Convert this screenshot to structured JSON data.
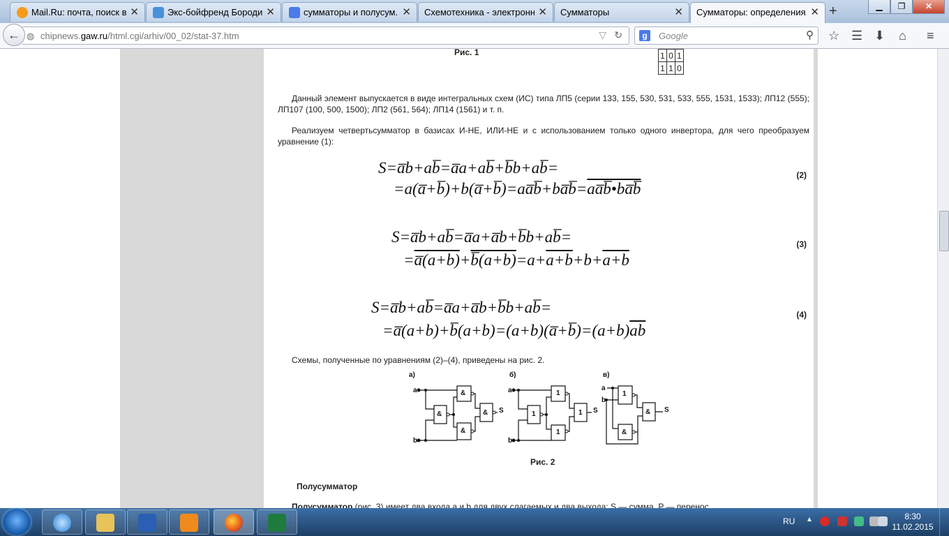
{
  "browser": {
    "tabs": [
      {
        "label": "Mail.Ru: почта, поиск в...",
        "icon": "mailru-icon",
        "color": "#f59b1a"
      },
      {
        "label": "Экс-бойфренд Бороди...",
        "icon": "person-icon",
        "color": "#4a90d9"
      },
      {
        "label": "сумматоры и полусум...",
        "icon": "google-icon",
        "color": "#4a7be8"
      },
      {
        "label": "Схемотехника - электронн...",
        "icon": "page-icon",
        "color": "#dddddd"
      },
      {
        "label": "Сумматоры",
        "icon": "page-icon",
        "color": "#dddddd"
      },
      {
        "label": "Сумматоры: определения,...",
        "icon": "page-icon",
        "color": "#dddddd"
      }
    ],
    "new_tab": "+",
    "url_prefix": "chipnews.",
    "url_domain": "gaw.ru",
    "url_path": "/html.cgi/arhiv/00_02/stat-37.htm",
    "search_engine_letter": "g",
    "search_placeholder": "Google"
  },
  "article": {
    "fig1_caption": "Рис. 1",
    "truth_rows": [
      [
        "1",
        "0",
        "1"
      ],
      [
        "1",
        "1",
        "0"
      ]
    ],
    "para1": "Данный элемент выпускается в виде интегральных схем (ИС) типа ЛП5 (серии 133, 155, 530, 531, 533, 555, 1531, 1533); ЛП12 (555); ЛП107 (100, 500, 1500); ЛП2 (561, 564); ЛП14 (1561) и т. п.",
    "para2": "Реализуем четвертьсумматор в базисах И-НЕ, ИЛИ-НЕ и с использованием только одного инвертора, для чего преобразуем уравнение (1):",
    "eq2_num": "(2)",
    "eq3_num": "(3)",
    "eq4_num": "(4)",
    "para3": "Схемы, полученные по уравнениям (2)–(4), приведены на рис. 2.",
    "fig2_labels": {
      "a": "а)",
      "b": "б)",
      "c": "в)",
      "in_a": "a",
      "in_b": "b",
      "out": "S",
      "and": "&",
      "or": "1"
    },
    "fig2_caption": "Рис. 2",
    "half_heading": "Полусумматор",
    "half_bold": "Полусумматор",
    "half_rest": " (рис. 3) имеет два входа a и b для двух слагаемых и два выхода: S — сумма, P — перенос"
  },
  "taskbar": {
    "lang": "RU",
    "time": "8:30",
    "date": "11.02.2015"
  }
}
